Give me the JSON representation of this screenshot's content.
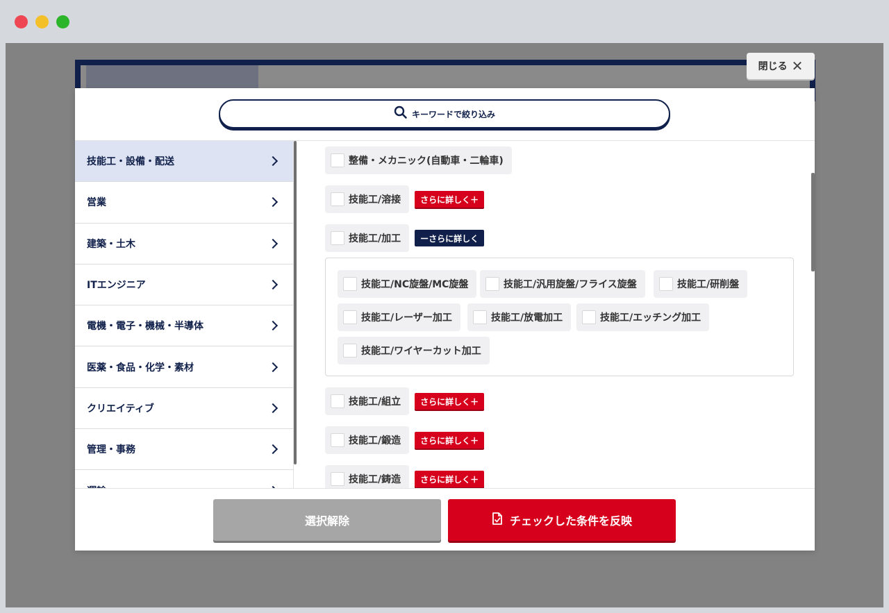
{
  "window": {
    "controls": [
      "close",
      "minimize",
      "maximize"
    ]
  },
  "modal": {
    "close_label": "閉じる",
    "search_label": "キーワードで絞り込み",
    "sidebar": [
      {
        "label": "技能工・設備・配送",
        "active": true
      },
      {
        "label": "営業"
      },
      {
        "label": "建築・土木"
      },
      {
        "label": "ITエンジニア"
      },
      {
        "label": "電機・電子・機械・半導体"
      },
      {
        "label": "医薬・食品・化学・素材"
      },
      {
        "label": "クリエイティブ"
      },
      {
        "label": "管理・事務"
      },
      {
        "label": "運輸"
      }
    ],
    "options": [
      {
        "label": "整備・メカニック(自動車・二輪車)"
      },
      {
        "label": "技能工/溶接",
        "more": "さらに詳しく＋"
      },
      {
        "label": "技能工/加工",
        "less": "ーさらに詳しく"
      },
      {
        "label": "技能工/組立",
        "more": "さらに詳しく＋"
      },
      {
        "label": "技能工/鍛造",
        "more": "さらに詳しく＋"
      },
      {
        "label": "技能工/鋳造",
        "more": "さらに詳しく＋"
      }
    ],
    "sub_options": [
      "技能工/NC旋盤/MC旋盤",
      "技能工/汎用旋盤/フライス旋盤",
      "技能工/研削盤",
      "技能工/レーザー加工",
      "技能工/放電加工",
      "技能工/エッチング加工",
      "技能工/ワイヤーカット加工"
    ],
    "clear_label": "選択解除",
    "apply_label": "チェックした条件を反映"
  },
  "colors": {
    "navy": "#10204a",
    "red": "#d6001c",
    "gray_button": "#a6a6a6",
    "active_bg": "#dde3f2"
  }
}
